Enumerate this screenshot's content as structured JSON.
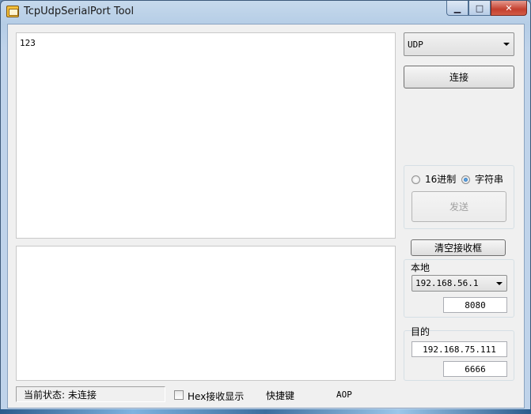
{
  "window": {
    "title": "TcpUdpSerialPort Tool"
  },
  "caption": {
    "minimize": "▁",
    "maximize": "□",
    "close": "✕"
  },
  "receive_area": {
    "text": "123"
  },
  "send_area": {
    "text": ""
  },
  "protocol": {
    "selected": "UDP"
  },
  "connect_button": "连接",
  "format": {
    "hex_label": "16进制",
    "string_label": "字符串",
    "selected": "字符串"
  },
  "send_button": "发送",
  "clear_button": "清空接收框",
  "local": {
    "label": "本地",
    "ip": "192.168.56.1",
    "port": "8080"
  },
  "target": {
    "label": "目的",
    "ip": "192.168.75.111",
    "port": "6666"
  },
  "status": {
    "text": "当前状态: 未连接"
  },
  "hex_display": {
    "label": "Hex接收显示",
    "checked": false
  },
  "shortcut_label": "快捷键",
  "aop_label": "AOP"
}
